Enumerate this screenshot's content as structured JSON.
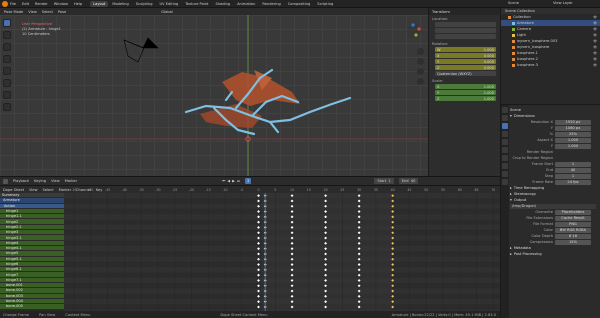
{
  "topbar": {
    "menu": [
      "File",
      "Edit",
      "Render",
      "Window",
      "Help"
    ],
    "workspaces": [
      "Layout",
      "Modeling",
      "Sculpting",
      "UV Editing",
      "Texture Paint",
      "Shading",
      "Animation",
      "Rendering",
      "Compositing",
      "Scripting"
    ],
    "active_workspace": "Layout",
    "scene": "Scene",
    "view_layer": "View Layer"
  },
  "viewport": {
    "mode": "Pose Mode",
    "menus": [
      "View",
      "Select",
      "Pose"
    ],
    "orientation": "Global",
    "info_view": "User Perspective",
    "info_object": "(2) Armature : hinge1",
    "info_units": "10 Centimeters"
  },
  "npanel": {
    "tab": "Transform",
    "location_label": "Location:",
    "rotation_label": "Rotation:",
    "rotation_values": [
      "1.000",
      "0.000",
      "0.000",
      "0.000"
    ],
    "mode_label": "Quaternion (WXYZ)",
    "scale_label": "Scale:",
    "scale_values": [
      "1.000",
      "1.000",
      "1.000"
    ]
  },
  "outliner": {
    "title": "Scene Collection",
    "items": [
      "Collection",
      "Armature",
      "Camera",
      "Light",
      "wyvern_Icosphere.003",
      "wyvern_Icosphere",
      "Icosphere.1",
      "Icosphere.2",
      "Icosphere.3"
    ]
  },
  "properties": {
    "scene_label": "Scene",
    "sections": {
      "dimensions": "Dimensions",
      "time_remapping": "Time Remapping",
      "stereoscopy": "Stereoscopy",
      "output": "Output",
      "metadata": "Metadata",
      "post_processing": "Post Processing"
    },
    "rows": [
      {
        "label": "Resolution X",
        "value": "1920 px"
      },
      {
        "label": "Y",
        "value": "1080 px"
      },
      {
        "label": "%",
        "value": "25%"
      },
      {
        "label": "Aspect X",
        "value": "1.000"
      },
      {
        "label": "Y",
        "value": "1.000"
      },
      {
        "label": "Render Region",
        "value": ""
      },
      {
        "label": "Crop to Render Region",
        "value": ""
      },
      {
        "label": "Frame Start",
        "value": "1"
      },
      {
        "label": "End",
        "value": "40"
      },
      {
        "label": "Step",
        "value": "1"
      },
      {
        "label": "Frame Rate",
        "value": "24 fps"
      }
    ],
    "output_path": "/tmp/Dragon\\",
    "output_rows": [
      {
        "label": "Overwrite",
        "value": "Placeholders"
      },
      {
        "label": "File Extensions",
        "value": "Cache Result"
      },
      {
        "label": "File Format",
        "value": "PNG"
      },
      {
        "label": "Color",
        "value": "BW   RGB   RGBA"
      },
      {
        "label": "Color Depth",
        "value": "8      16"
      },
      {
        "label": "Compression",
        "value": "15%"
      }
    ]
  },
  "timeline": {
    "menus": [
      "Playback",
      "Keying",
      "View",
      "Marker"
    ],
    "current_frame": "2",
    "start_label": "Start",
    "start_value": "1",
    "end_label": "End",
    "end_value": "40"
  },
  "dopesheet": {
    "mode": "Dope Sheet",
    "menus": [
      "View",
      "Select",
      "Marker",
      "Channel",
      "Key"
    ],
    "summary": "Summary",
    "armature": "Armature",
    "action": "Action",
    "channels": [
      "hinge1",
      "hinge1.1",
      "hinge2",
      "hinge2.1",
      "hinge3",
      "hinge3.1",
      "hinge4",
      "hinge4.1",
      "hinge5",
      "hinge5.1",
      "hinge6",
      "hinge6.1",
      "hinge7",
      "hinge7.1",
      "bone.001",
      "bone.002",
      "bone.003",
      "bone.004",
      "bone.005"
    ],
    "ruler_ticks": [
      "-55",
      "-50",
      "-45",
      "-40",
      "-35",
      "-30",
      "-25",
      "-20",
      "-15",
      "-10",
      "-5",
      "0",
      "5",
      "10",
      "15",
      "20",
      "25",
      "30",
      "35",
      "40",
      "45",
      "50",
      "55",
      "60",
      "65",
      "70"
    ],
    "key_frames": [
      0,
      2,
      10,
      20,
      30,
      40
    ]
  },
  "status": {
    "items": [
      "Change Frame",
      "Pan View",
      "Context Menu",
      "Dope Sheet Context Menu"
    ],
    "version": "Armature | Bones:22/22 | Verts:0 | Mem: 49.1 MiB | 2.83.0"
  },
  "colors": {
    "accent": "#4772b3",
    "bone": "#7fbfe0",
    "mesh": "#c0633a",
    "key": "#ffffff",
    "playhead": "#4772b3"
  }
}
